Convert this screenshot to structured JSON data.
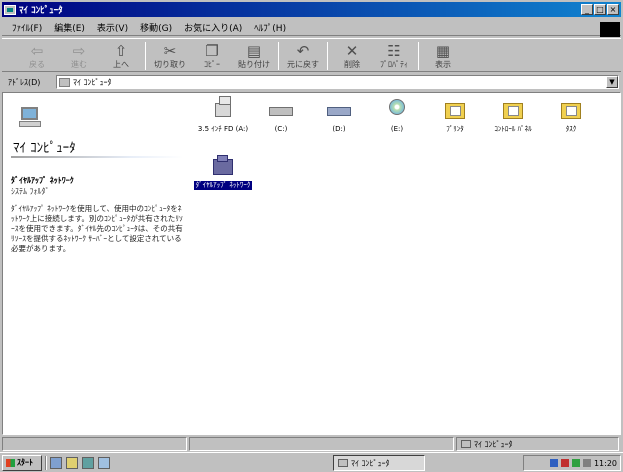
{
  "window": {
    "title": "ﾏｲ ｺﾝﾋﾟｭｰﾀ",
    "controls": [
      "_",
      "□",
      "×"
    ]
  },
  "menubar": {
    "items": [
      "ﾌｧｲﾙ(F)",
      "編集(E)",
      "表示(V)",
      "移動(G)",
      "お気に入り(A)",
      "ﾍﾙﾌﾟ(H)"
    ]
  },
  "toolbar": {
    "buttons": [
      {
        "label": "戻る",
        "icon": "back-arrow-icon",
        "glyph": "⇦"
      },
      {
        "label": "進む",
        "icon": "forward-arrow-icon",
        "glyph": "⇨"
      },
      {
        "label": "上へ",
        "icon": "up-folder-icon",
        "glyph": "⇧"
      },
      {
        "label": "切り取り",
        "icon": "scissors-icon",
        "glyph": "✂"
      },
      {
        "label": "ｺﾋﾟｰ",
        "icon": "copy-icon",
        "glyph": "❐"
      },
      {
        "label": "貼り付け",
        "icon": "paste-icon",
        "glyph": "▤"
      },
      {
        "label": "元に戻す",
        "icon": "undo-icon",
        "glyph": "↶"
      },
      {
        "label": "削除",
        "icon": "delete-x-icon",
        "glyph": "✕"
      },
      {
        "label": "ﾌﾟﾛﾊﾟﾃｨ",
        "icon": "properties-icon",
        "glyph": "☷"
      },
      {
        "label": "表示",
        "icon": "views-icon",
        "glyph": "▦"
      }
    ]
  },
  "addressbar": {
    "label": "ｱﾄﾞﾚｽ(D)",
    "value": "ﾏｲ ｺﾝﾋﾟｭｰﾀ",
    "dropdown_glyph": "▼"
  },
  "leftpane": {
    "title": "ﾏｲ ｺﾝﾋﾟｭｰﾀ",
    "selected_name": "ﾀﾞｲﾔﾙｱｯﾌﾟ ﾈｯﾄﾜｰｸ",
    "selected_type": "ｼｽﾃﾑ ﾌｫﾙﾀﾞ",
    "description": "ﾀﾞｲﾔﾙｱｯﾌﾟ ﾈｯﾄﾜｰｸを使用して、使用中のｺﾝﾋﾟｭｰﾀをﾈｯﾄﾜｰｸ上に接続します。別のｺﾝﾋﾟｭｰﾀが共有されたﾘｿｰｽを使用できます。ﾀﾞｲﾔﾙ先のｺﾝﾋﾟｭｰﾀは、その共有ﾘｿｰｽを提供するﾈｯﾄﾜｰｸ ｻｰﾊﾞｰとして設定されている必要があります。"
  },
  "icons": [
    {
      "label": "3.5 ｲﾝﾁ FD (A:)",
      "kind": "floppy-drive-icon"
    },
    {
      "label": "(C:)",
      "kind": "hard-drive-icon"
    },
    {
      "label": "(D:)",
      "kind": "hard-drive-icon"
    },
    {
      "label": "(E:)",
      "kind": "cd-drive-icon"
    },
    {
      "label": "ﾌﾟﾘﾝﾀ",
      "kind": "printers-folder-icon"
    },
    {
      "label": "ｺﾝﾄﾛｰﾙ ﾊﾟﾈﾙ",
      "kind": "control-panel-folder-icon"
    },
    {
      "label": "ﾀｽｸ",
      "kind": "scheduled-tasks-folder-icon"
    },
    {
      "label": "ﾀﾞｲﾔﾙｱｯﾌﾟ ﾈｯﾄﾜｰｸ",
      "kind": "dial-up-networking-icon",
      "selected": true
    }
  ],
  "statusbar": {
    "location": "ﾏｲ ｺﾝﾋﾟｭｰﾀ"
  },
  "taskbar": {
    "start_label": "ｽﾀｰﾄ",
    "task_button": "ﾏｲ ｺﾝﾋﾟｭｰﾀ",
    "clock": "11:20"
  }
}
